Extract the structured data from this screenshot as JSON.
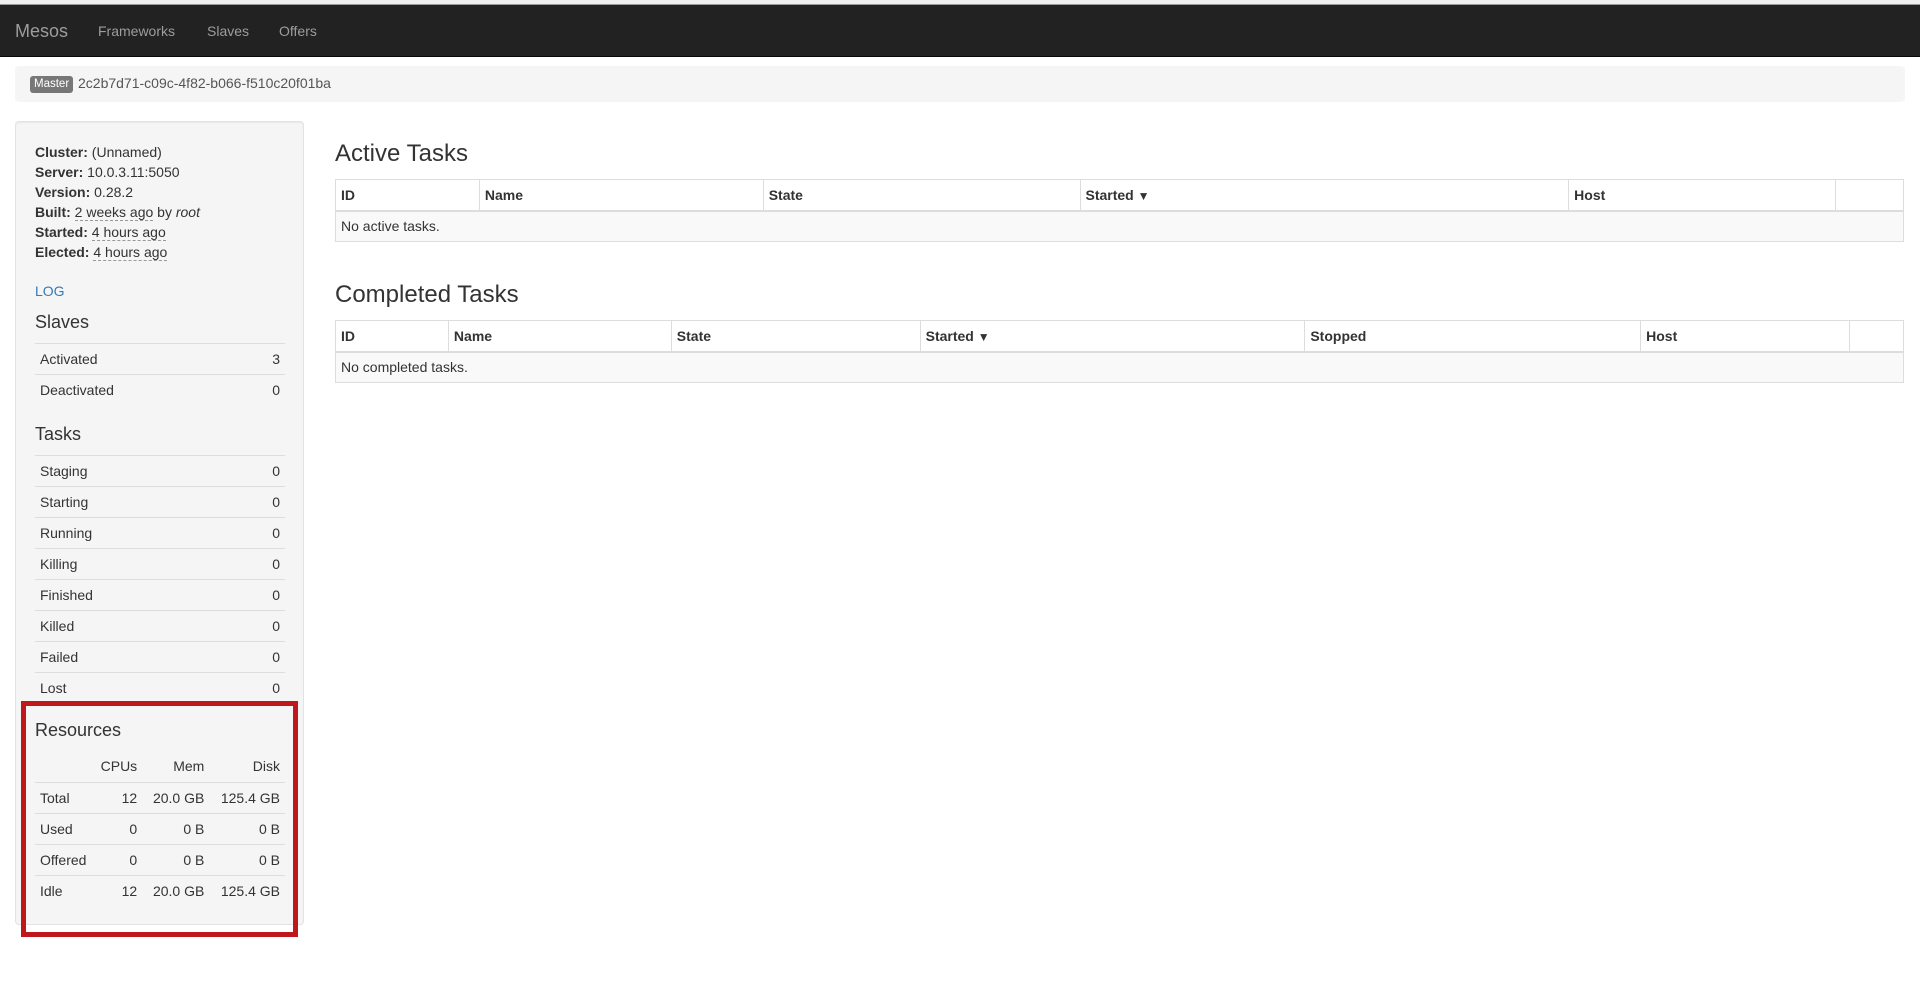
{
  "navbar": {
    "brand": "Mesos",
    "links": [
      "Frameworks",
      "Slaves",
      "Offers"
    ]
  },
  "breadcrumb": {
    "badge": "Master",
    "master_id": "2c2b7d71-c09c-4f82-b066-f510c20f01ba"
  },
  "sidebar": {
    "info": {
      "cluster_label": "Cluster:",
      "cluster": "(Unnamed)",
      "server_label": "Server:",
      "server": "10.0.3.11:5050",
      "version_label": "Version:",
      "version": "0.28.2",
      "built_label": "Built:",
      "built": "2 weeks ago",
      "built_by": "by",
      "built_user": "root",
      "started_label": "Started:",
      "started": "4 hours ago",
      "elected_label": "Elected:",
      "elected": "4 hours ago"
    },
    "log_link": "LOG",
    "slaves": {
      "title": "Slaves",
      "rows": [
        {
          "label": "Activated",
          "value": "3"
        },
        {
          "label": "Deactivated",
          "value": "0"
        }
      ]
    },
    "tasks": {
      "title": "Tasks",
      "rows": [
        {
          "label": "Staging",
          "value": "0"
        },
        {
          "label": "Starting",
          "value": "0"
        },
        {
          "label": "Running",
          "value": "0"
        },
        {
          "label": "Killing",
          "value": "0"
        },
        {
          "label": "Finished",
          "value": "0"
        },
        {
          "label": "Killed",
          "value": "0"
        },
        {
          "label": "Failed",
          "value": "0"
        },
        {
          "label": "Lost",
          "value": "0"
        }
      ]
    },
    "resources": {
      "title": "Resources",
      "columns": [
        "CPUs",
        "Mem",
        "Disk"
      ],
      "rows": [
        {
          "label": "Total",
          "cpus": "12",
          "mem": "20.0 GB",
          "disk": "125.4 GB"
        },
        {
          "label": "Used",
          "cpus": "0",
          "mem": "0 B",
          "disk": "0 B"
        },
        {
          "label": "Offered",
          "cpus": "0",
          "mem": "0 B",
          "disk": "0 B"
        },
        {
          "label": "Idle",
          "cpus": "12",
          "mem": "20.0 GB",
          "disk": "125.4 GB"
        }
      ],
      "highlight_color": "#c0171d"
    }
  },
  "main": {
    "active": {
      "title": "Active Tasks",
      "columns": [
        "ID",
        "Name",
        "State",
        "Started",
        "Host",
        ""
      ],
      "sort_indicator": "▼",
      "empty": "No active tasks."
    },
    "completed": {
      "title": "Completed Tasks",
      "columns": [
        "ID",
        "Name",
        "State",
        "Started",
        "Stopped",
        "Host",
        ""
      ],
      "sort_indicator": "▼",
      "empty": "No completed tasks."
    }
  }
}
